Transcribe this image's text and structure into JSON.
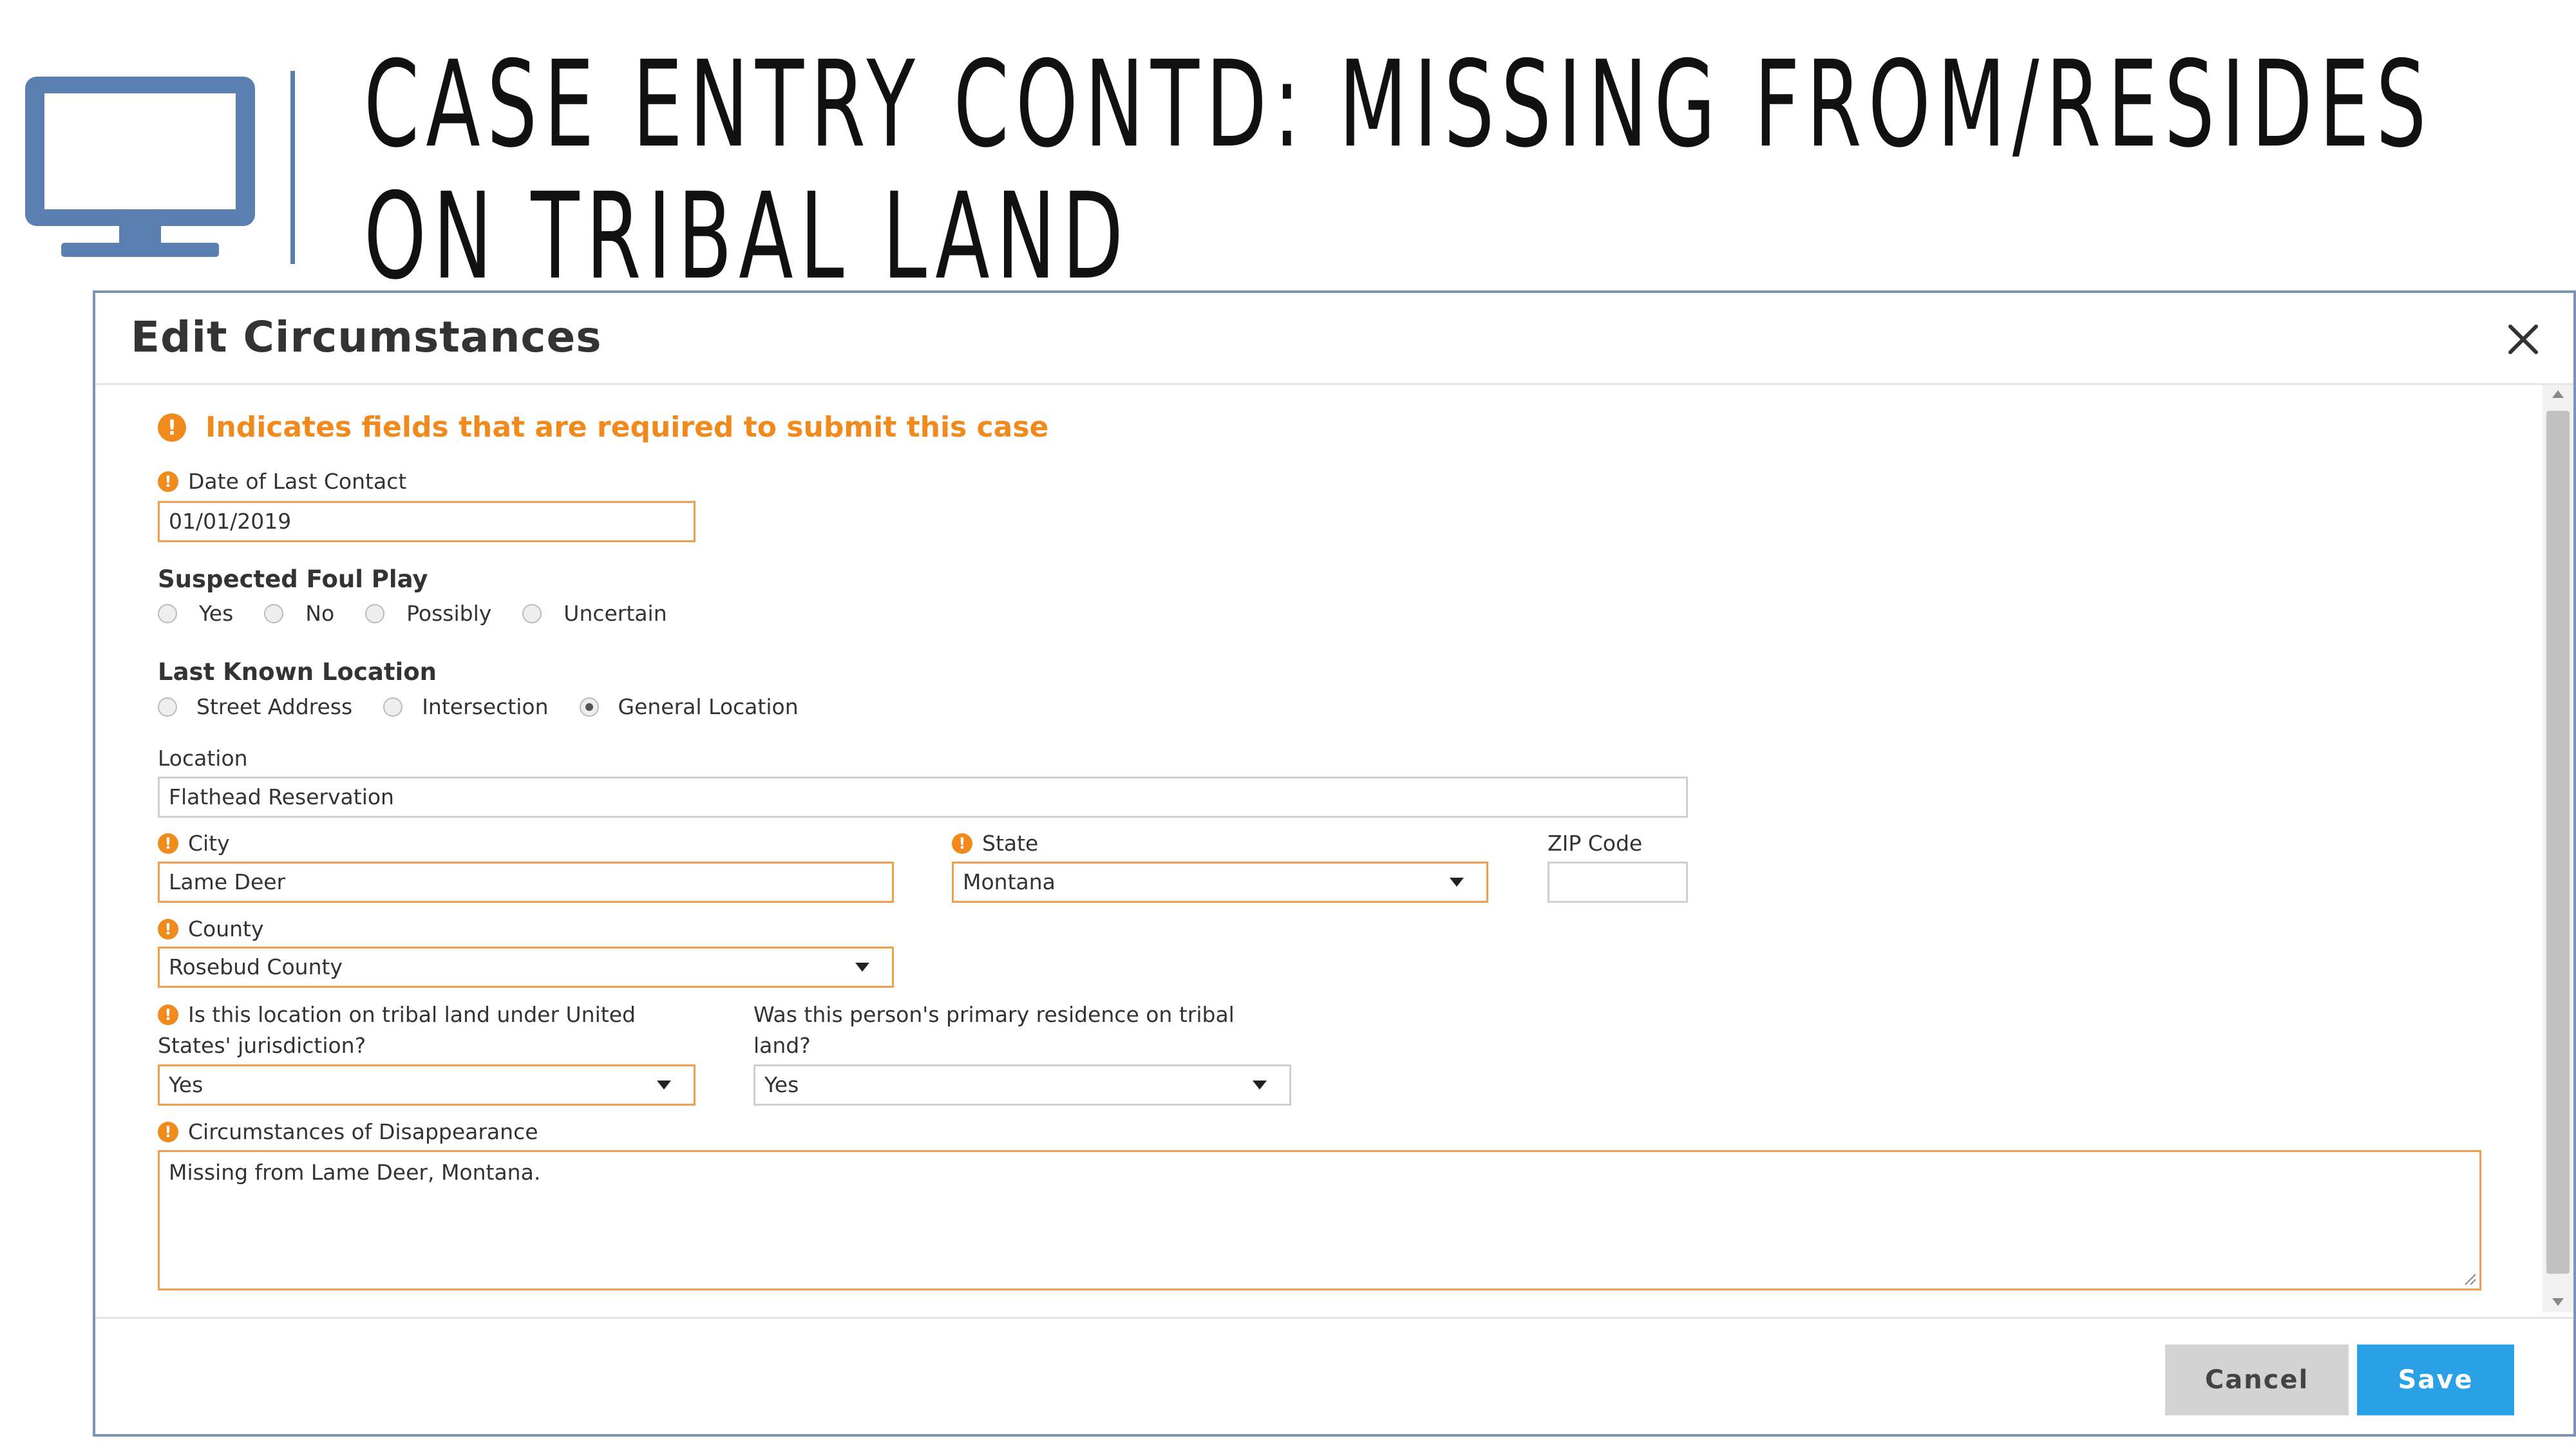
{
  "slide": {
    "title_line1": "CASE ENTRY CONTD: MISSING FROM/RESIDES",
    "title_line2": "ON TRIBAL LAND",
    "icon": "monitor-icon",
    "accent_color": "#5b7fb0"
  },
  "modal": {
    "title": "Edit Circumstances",
    "close_icon": "close-icon",
    "required_note": "Indicates fields that are required to submit this case",
    "required_color": "#f08a1c",
    "fields": {
      "date_of_last_contact": {
        "label": "Date of Last Contact",
        "value": "01/01/2019"
      },
      "suspected_foul_play": {
        "label": "Suspected Foul Play",
        "options": [
          "Yes",
          "No",
          "Possibly",
          "Uncertain"
        ],
        "selected": null
      },
      "last_known_location": {
        "label": "Last Known Location",
        "options": [
          "Street Address",
          "Intersection",
          "General Location"
        ],
        "selected": "General Location"
      },
      "location": {
        "label": "Location",
        "value": "Flathead Reservation"
      },
      "city": {
        "label": "City",
        "value": "Lame Deer"
      },
      "state": {
        "label": "State",
        "value": "Montana"
      },
      "zip": {
        "label": "ZIP Code",
        "value": ""
      },
      "county": {
        "label": "County",
        "value": "Rosebud County"
      },
      "tribal_land": {
        "label_line1": "Is this location on tribal land under United",
        "label_line2": "States' jurisdiction?",
        "value": "Yes"
      },
      "primary_residence": {
        "label_line1": "Was this person's primary residence on tribal",
        "label_line2": "land?",
        "value": "Yes"
      },
      "circumstances": {
        "label": "Circumstances of Disappearance",
        "value": "Missing from Lame Deer, Montana."
      }
    },
    "buttons": {
      "cancel": "Cancel",
      "save": "Save"
    },
    "save_color": "#2aa0e6"
  }
}
